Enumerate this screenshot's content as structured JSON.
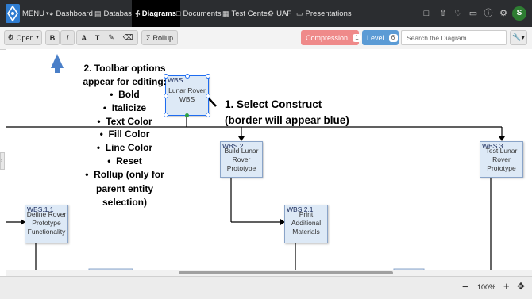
{
  "nav": {
    "menu_label": "MENU",
    "items": [
      {
        "label": "Dashboard",
        "icon": "speedometer-icon"
      },
      {
        "label": "Database",
        "icon": "database-icon"
      },
      {
        "label": "Diagrams",
        "icon": "diagram-icon",
        "active": true
      },
      {
        "label": "Documents",
        "icon": "document-icon"
      },
      {
        "label": "Test Center",
        "icon": "calendar-icon"
      },
      {
        "label": "UAF",
        "icon": "gear-icon"
      },
      {
        "label": "Presentations",
        "icon": "presentation-icon"
      }
    ],
    "right_icons": [
      "chat-icon",
      "upload-icon",
      "bell-icon",
      "folder-icon",
      "help-icon",
      "settings-icon"
    ],
    "avatar": "S"
  },
  "toolbar": {
    "open_label": "Open",
    "bold": "B",
    "italic": "I",
    "text_color": "A",
    "fill_color": "T",
    "rollup_label": "Rollup",
    "compression_label": "Compression",
    "compression_count": "1",
    "level_label": "Level",
    "level_count": "6",
    "search_placeholder": "Search the Diagram..."
  },
  "colors": {
    "compression": "#ef8a8a",
    "level": "#5b9bd5",
    "selection": "#1e6cf0",
    "callout_arrow": "#4a7fc8"
  },
  "diagram": {
    "root": {
      "wbs": "WBS.",
      "name": [
        "Lunar Rover",
        "WBS"
      ]
    },
    "nodes": [
      {
        "wbs": "WBS.2",
        "name": [
          "Build Lunar",
          "Rover",
          "Prototype"
        ]
      },
      {
        "wbs": "WBS.3",
        "name": [
          "Test Lunar",
          "Rover",
          "Prototype"
        ]
      },
      {
        "wbs": "WBS.1.1",
        "name": [
          "Define Rover",
          "Prototype",
          "Functionality"
        ]
      },
      {
        "wbs": "WBS.2.1",
        "name": [
          "Print",
          "Additional",
          "Materials"
        ]
      }
    ]
  },
  "annotations": {
    "step1": [
      "1. Select Construct",
      "(border will appear blue)"
    ],
    "step2_title": [
      "2. Toolbar options",
      "appear for editing:"
    ],
    "step2_items": [
      "Bold",
      "Italicize",
      "Text Color",
      "Fill Color",
      "Line Color",
      "Reset"
    ],
    "step2_last": [
      "Rollup (only for",
      "parent entity",
      "selection)"
    ]
  },
  "status": {
    "zoom": "100%",
    "minus": "−",
    "plus": "+"
  }
}
